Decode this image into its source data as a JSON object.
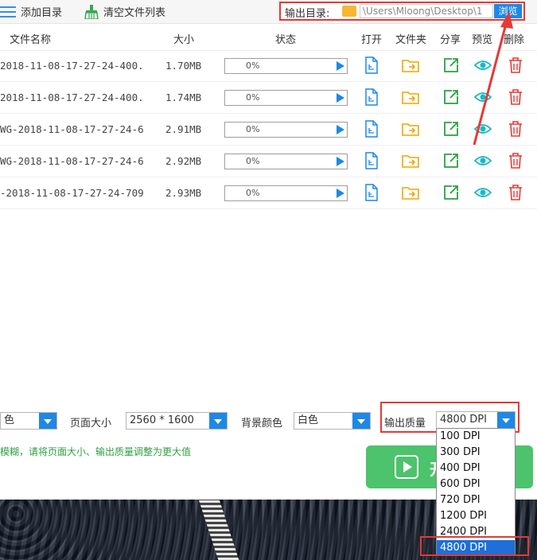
{
  "toolbar": {
    "add_dir": "添加目录",
    "clear_list": "清空文件列表",
    "output_label": "输出目录:",
    "output_path": "\\Users\\Mloong\\Desktop\\1",
    "browse": "浏览"
  },
  "table": {
    "headers": {
      "name": "文件名称",
      "size": "大小",
      "status": "状态",
      "open": "打开",
      "folder": "文件夹",
      "share": "分享",
      "preview": "预览",
      "delete": "删除"
    },
    "rows": [
      {
        "name": "2018-11-08-17-27-24-400.",
        "size": "1.70MB",
        "progress": 0,
        "progress_text": "0%"
      },
      {
        "name": "2018-11-08-17-27-24-400.",
        "size": "1.74MB",
        "progress": 0,
        "progress_text": "0%"
      },
      {
        "name": "WG-2018-11-08-17-27-24-6",
        "size": "2.91MB",
        "progress": 0,
        "progress_text": "0%"
      },
      {
        "name": "WG-2018-11-08-17-27-24-6",
        "size": "2.92MB",
        "progress": 0,
        "progress_text": "0%"
      },
      {
        "name": "-2018-11-08-17-27-24-709",
        "size": "2.93MB",
        "progress": 0,
        "progress_text": "0%"
      }
    ]
  },
  "settings": {
    "color_mode_value": "色",
    "page_size_label": "页面大小",
    "page_size_value": "2560 * 1600",
    "bg_color_label": "背景颜色",
    "bg_color_value": "白色",
    "quality_label": "输出质量",
    "quality_value": "4800 DPI",
    "quality_options": [
      "100 DPI",
      "300 DPI",
      "400 DPI",
      "600 DPI",
      "720 DPI",
      "1200 DPI",
      "2400 DPI",
      "4800 DPI"
    ],
    "quality_selected_index": 7
  },
  "hint": "模糊，请将页面大小、输出质量调整为更大值",
  "start_button": "开",
  "colors": {
    "accent": "#1e88e5",
    "annotation": "#e53935",
    "start": "#4cc36c",
    "hint": "#2e9e44"
  }
}
